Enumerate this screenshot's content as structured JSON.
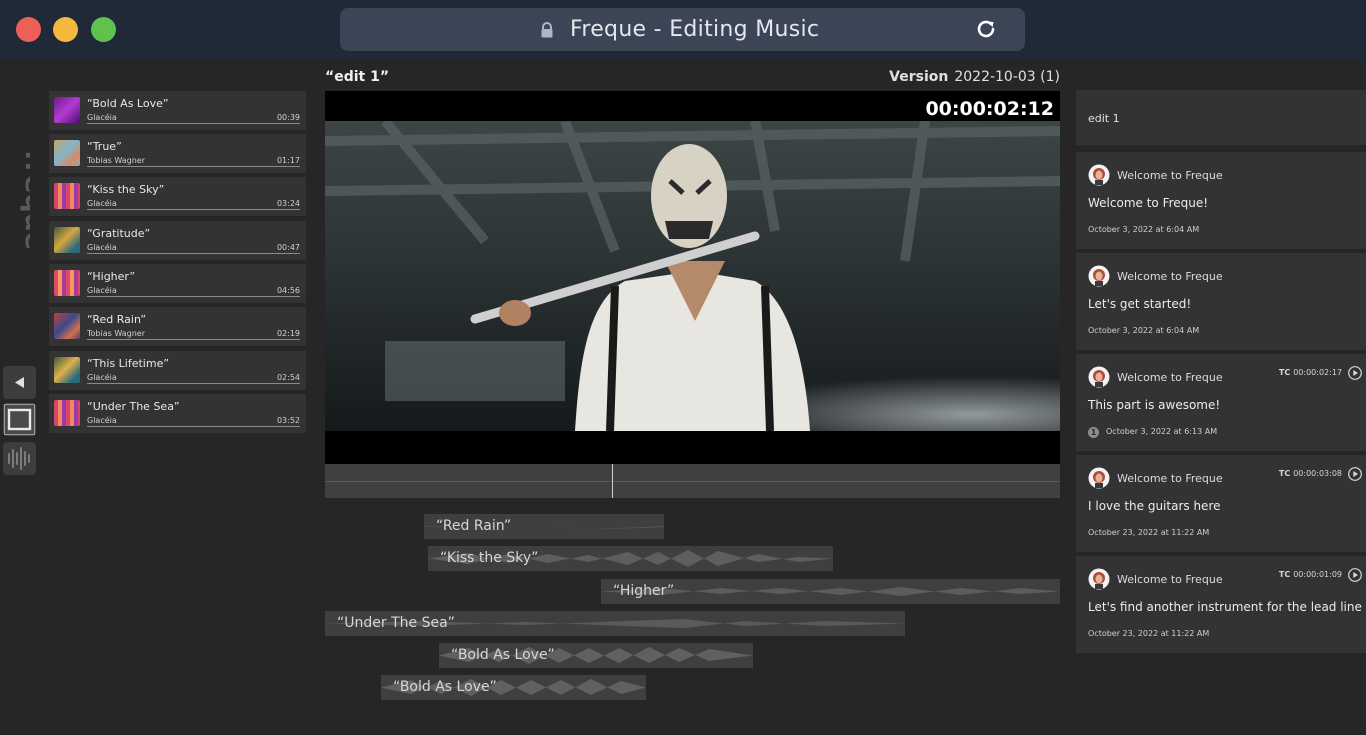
{
  "window": {
    "title": "Freque - Editing Music",
    "colors": {
      "close": "#ee5f57",
      "minimize": "#f4b83f",
      "maximize": "#5fc24f"
    }
  },
  "brand": {
    "logo": "freque"
  },
  "library": {
    "tracks": [
      {
        "name": "“Bold As Love”",
        "artist": "Glacéia",
        "duration": "00:39"
      },
      {
        "name": "“True”",
        "artist": "Tobias Wagner",
        "duration": "01:17"
      },
      {
        "name": "“Kiss the Sky”",
        "artist": "Glacéia",
        "duration": "03:24"
      },
      {
        "name": "“Gratitude”",
        "artist": "Glacéia",
        "duration": "00:47"
      },
      {
        "name": "“Higher”",
        "artist": "Glacéia",
        "duration": "04:56"
      },
      {
        "name": "“Red Rain”",
        "artist": "Tobias Wagner",
        "duration": "02:19"
      },
      {
        "name": "“This Lifetime”",
        "artist": "Glacéia",
        "duration": "02:54"
      },
      {
        "name": "“Under The Sea”",
        "artist": "Glacéia",
        "duration": "03:52"
      }
    ]
  },
  "editor": {
    "edit_name": "“edit 1”",
    "version_label": "Version",
    "version_value": "2022-10-03 (1)",
    "timecode": "00:00:02:12",
    "lanes": [
      {
        "name": "“Red Rain”"
      },
      {
        "name": "“Kiss the Sky”"
      },
      {
        "name": "“Higher”"
      },
      {
        "name": "“Under The Sea”"
      },
      {
        "name": "“Bold As Love”"
      },
      {
        "name": "“Bold As Love”"
      }
    ]
  },
  "comments": {
    "edit_title": "edit 1",
    "items": [
      {
        "author": "Welcome to Freque",
        "body": "Welcome to Freque!",
        "date": "October 3, 2022 at 6:04 AM"
      },
      {
        "author": "Welcome to Freque",
        "body": "Let's get started!",
        "date": "October 3, 2022 at 6:04 AM"
      },
      {
        "author": "Welcome to Freque",
        "body": "This part is awesome!",
        "date": "October 3, 2022 at 6:13 AM",
        "tc_label": "TC",
        "tc": "00:00:02:17",
        "replies": "1"
      },
      {
        "author": "Welcome to Freque",
        "body": "I love the guitars here",
        "date": "October 23, 2022 at 11:22 AM",
        "tc_label": "TC",
        "tc": "00:00:03:08"
      },
      {
        "author": "Welcome to Freque",
        "body": "Let's find another instrument for the lead line",
        "date": "October 23, 2022 at 11:22 AM",
        "tc_label": "TC",
        "tc": "00:00:01:09"
      }
    ]
  }
}
